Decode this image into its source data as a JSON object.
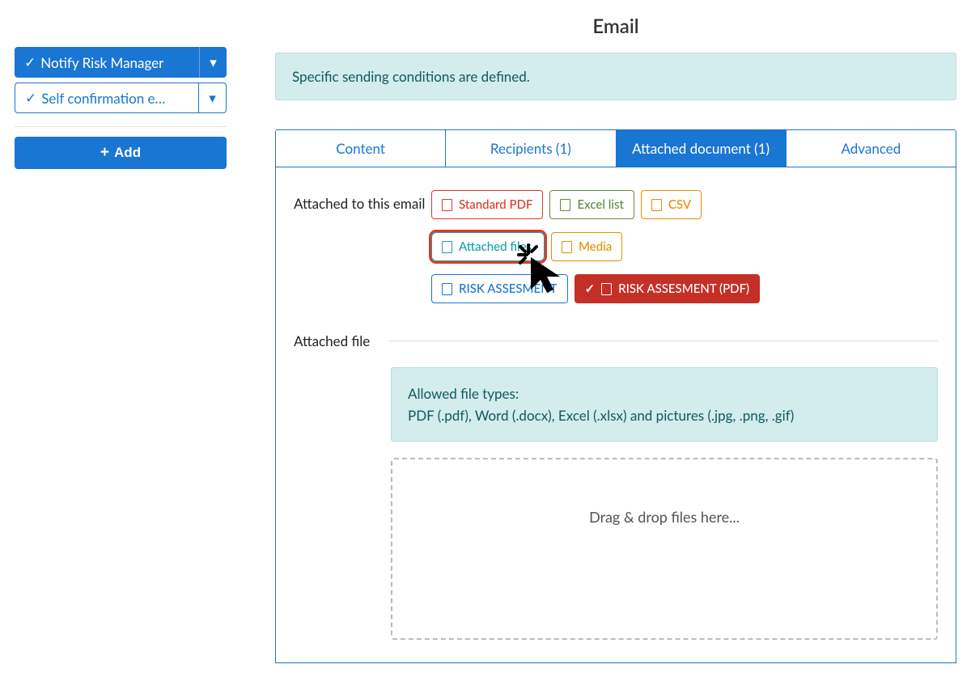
{
  "page": {
    "title": "Email"
  },
  "sidebar": {
    "items": [
      {
        "label": "Notify Risk Manager"
      },
      {
        "label": "Self confirmation e…"
      }
    ],
    "add_label": "Add"
  },
  "info": {
    "conditions_msg": "Specific sending conditions are defined."
  },
  "tabs": {
    "content": "Content",
    "recipients": "Recipients (1)",
    "attached": "Attached document (1)",
    "advanced": "Advanced"
  },
  "attach": {
    "label": "Attached to this email",
    "chips": {
      "standard_pdf": "Standard PDF",
      "excel_list": "Excel list",
      "csv": "CSV",
      "attached_files": "Attached files",
      "media": "Media",
      "risk_assesment": "RISK ASSESMENT",
      "risk_assesment_pdf": "RISK ASSESMENT (PDF)"
    }
  },
  "file_section": {
    "label": "Attached file",
    "allowed_title": "Allowed file types:",
    "allowed_text": "PDF (.pdf), Word (.docx), Excel (.xlsx) and pictures (.jpg, .png, .gif)",
    "drop_hint": "Drag & drop files here..."
  },
  "glyphs": {
    "check": "✓",
    "caret": "▾",
    "plus": "+"
  }
}
